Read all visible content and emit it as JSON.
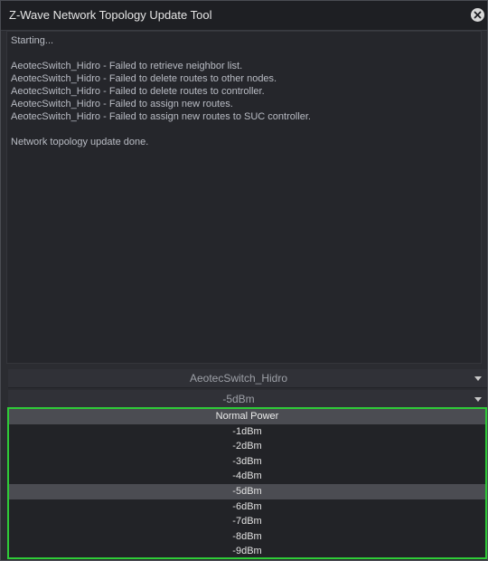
{
  "window": {
    "title": "Z-Wave Network Topology Update Tool",
    "close_icon": "close-icon"
  },
  "log": {
    "lines": [
      "Starting...",
      "",
      "AeotecSwitch_Hidro - Failed to retrieve neighbor list.",
      "AeotecSwitch_Hidro - Failed to delete routes to other nodes.",
      "AeotecSwitch_Hidro - Failed to delete routes to controller.",
      "AeotecSwitch_Hidro - Failed to assign new routes.",
      "AeotecSwitch_Hidro - Failed to assign new routes to SUC controller.",
      "",
      "Network topology update done."
    ]
  },
  "device_select": {
    "value": "AeotecSwitch_Hidro",
    "arrow_icon": "caret-down-icon"
  },
  "power_select": {
    "value": "-5dBm",
    "arrow_icon": "caret-down-icon",
    "options": [
      "Normal Power",
      "-1dBm",
      "-2dBm",
      "-3dBm",
      "-4dBm",
      "-5dBm",
      "-6dBm",
      "-7dBm",
      "-8dBm",
      "-9dBm"
    ],
    "highlighted": "-5dBm"
  },
  "colors": {
    "dropdown_border": "#2fcb38",
    "selected_option_bg": "#4b4c52",
    "window_bg": "#2b2c31"
  }
}
